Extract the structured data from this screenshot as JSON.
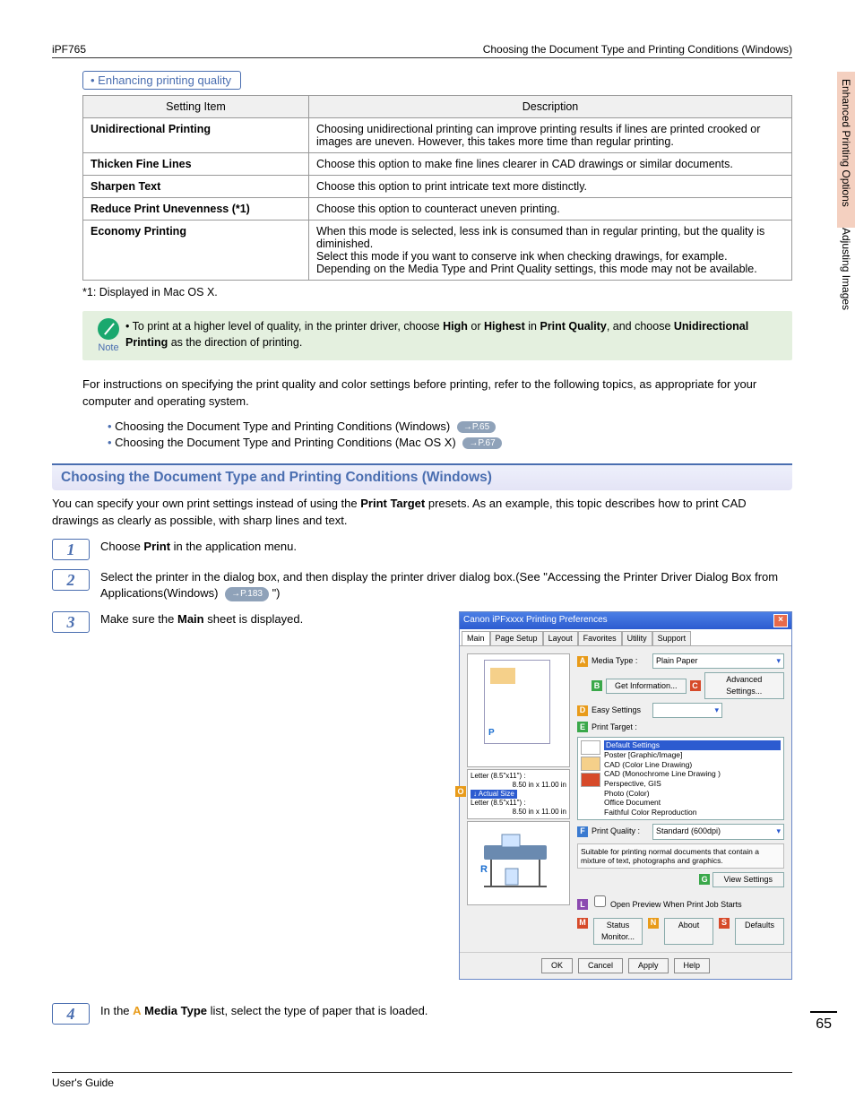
{
  "header": {
    "left": "iPF765",
    "right": "Choosing the Document Type and Printing Conditions (Windows)"
  },
  "side_tabs": [
    "Enhanced Printing Options",
    "Adjusting Images"
  ],
  "page_number": "65",
  "footer": "User's Guide",
  "sub_bullet_title": "Enhancing printing quality",
  "table": {
    "headers": [
      "Setting Item",
      "Description"
    ],
    "rows": [
      {
        "k": "Unidirectional Printing",
        "d": "Choosing unidirectional printing can improve printing results if lines are printed crooked or images are uneven. However, this takes more time than regular printing."
      },
      {
        "k": "Thicken Fine Lines",
        "d": "Choose this option to make fine lines clearer in CAD drawings or similar documents."
      },
      {
        "k": "Sharpen Text",
        "d": "Choose this option to print intricate text more distinctly."
      },
      {
        "k": "Reduce Print Unevenness (*1)",
        "d": "Choose this option to counteract uneven printing."
      },
      {
        "k": "Economy Printing",
        "d": "When this mode is selected, less ink is consumed than in regular printing, but the quality is diminished.\nSelect this mode if you want to conserve ink when checking drawings, for example. Depending on the Media Type and Print Quality settings, this mode may not be available."
      }
    ]
  },
  "table_footnote": "*1: Displayed in Mac OS X.",
  "note": {
    "label": "Note",
    "text_pre": "To print at a higher level of quality, in the printer driver, choose ",
    "b1": "High",
    "or": " or ",
    "b2": "Highest",
    "in": " in ",
    "b3": "Print Quality",
    "and": ", and choose ",
    "b4": "Unidirectional Printing",
    "post": " as the direction of printing."
  },
  "para1": "For instructions on specifying the print quality and color settings before printing, refer to the following topics, as appropriate for your computer and operating system.",
  "xlinks": [
    {
      "text": "Choosing the Document Type and Printing Conditions (Windows)",
      "pill": "→P.65"
    },
    {
      "text": "Choosing the Document Type and Printing Conditions (Mac OS X)",
      "pill": "→P.67"
    }
  ],
  "section_heading": "Choosing the Document Type and Printing Conditions (Windows)",
  "intro": {
    "pre": "You can specify your own print settings instead of using the ",
    "b": "Print Target",
    "post": " presets. As an example, this topic describes how to print CAD drawings as clearly as possible, with sharp lines and text."
  },
  "steps": {
    "s1": {
      "n": "1",
      "pre": "Choose ",
      "b": "Print",
      "post": " in the application menu."
    },
    "s2": {
      "n": "2",
      "pre": "Select the printer in the dialog box, and then display the printer driver dialog box.(See \"Accessing the Printer Driver Dialog Box from Applications(Windows) ",
      "pill": "→P.183",
      "post": " \")"
    },
    "s3": {
      "n": "3",
      "pre": "Make sure the ",
      "b": "Main",
      "post": " sheet is displayed."
    },
    "s4": {
      "n": "4",
      "pre": "In the ",
      "letter": "A",
      "b": "Media Type",
      "post": " list, select the type of paper that is loaded."
    }
  },
  "dialog": {
    "title": "Canon iPFxxxx Printing Preferences",
    "tabs": [
      "Main",
      "Page Setup",
      "Layout",
      "Favorites",
      "Utility",
      "Support"
    ],
    "preview_label": "P",
    "size": {
      "l1": "Letter (8.5\"x11\") :",
      "l1v": "8.50 in x 11.00 in",
      "act": "↓   Actual Size",
      "l2": "Letter (8.5\"x11\") :",
      "l2v": "8.50 in x 11.00 in"
    },
    "printer_label": "R",
    "rowA": {
      "tag": "A",
      "label": "Media Type :",
      "value": "Plain Paper"
    },
    "rowB": {
      "tag": "B",
      "btn1": "Get Information...",
      "tagC": "C",
      "btn2": "Advanced Settings..."
    },
    "rowD": {
      "tag": "D",
      "label": "Easy Settings"
    },
    "rowE": {
      "tag": "E",
      "label": "Print Target :"
    },
    "targets": [
      "Default Settings",
      "Poster [Graphic/Image]",
      "CAD (Color Line Drawing)",
      "CAD (Monochrome Line Drawing )",
      "Perspective, GIS",
      "Photo (Color)",
      "Office Document",
      "Faithful Color Reproduction"
    ],
    "rowF": {
      "tag": "F",
      "label": "Print Quality :",
      "value": "Standard (600dpi)"
    },
    "desc": "Suitable for printing normal documents that contain a mixture of text, photographs and graphics.",
    "view": {
      "tag": "G",
      "btn": "View Settings"
    },
    "rowL": {
      "tag": "L",
      "label": "Open Preview When Print Job Starts"
    },
    "bottom": {
      "tagM": "M",
      "b1": "Status Monitor...",
      "tagN": "N",
      "b2": "About",
      "tagS": "S",
      "b3": "Defaults"
    },
    "final": [
      "OK",
      "Cancel",
      "Apply",
      "Help"
    ],
    "sidebar_tag": "O"
  }
}
